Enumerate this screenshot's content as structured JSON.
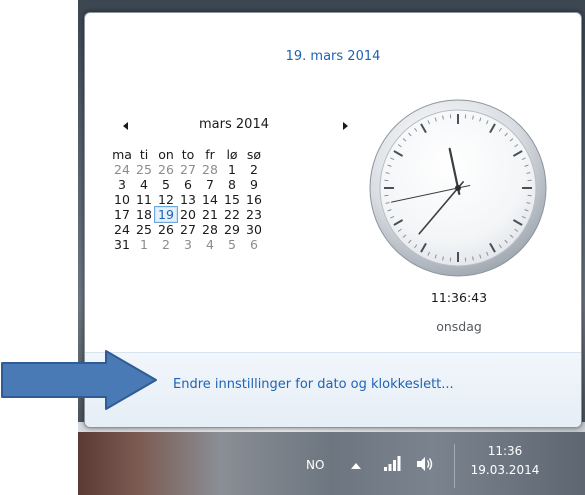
{
  "calendar": {
    "date_heading": "19. mars 2014",
    "month_title": "mars 2014",
    "prev_icon": "triangle-left-icon",
    "next_icon": "triangle-right-icon",
    "weekdays": [
      "ma",
      "ti",
      "on",
      "to",
      "fr",
      "lø",
      "sø"
    ],
    "weeks": [
      [
        "24",
        "25",
        "26",
        "27",
        "28",
        "1",
        "2"
      ],
      [
        "3",
        "4",
        "5",
        "6",
        "7",
        "8",
        "9"
      ],
      [
        "10",
        "11",
        "12",
        "13",
        "14",
        "15",
        "16"
      ],
      [
        "17",
        "18",
        "19",
        "20",
        "21",
        "22",
        "23"
      ],
      [
        "24",
        "25",
        "26",
        "27",
        "28",
        "29",
        "30"
      ],
      [
        "31",
        "1",
        "2",
        "3",
        "4",
        "5",
        "6"
      ]
    ],
    "selected_day": "19",
    "accent_color": "#1e63b4"
  },
  "clock": {
    "time": "11:36:43",
    "day": "onsdag",
    "hour": 11,
    "minute": 36,
    "second": 43
  },
  "footer": {
    "settings_link": "Endre innstillinger for dato og klokkeslett..."
  },
  "annotation": {
    "arrow_color": "#4a7ab5",
    "arrow_icon": "right-arrow-icon"
  },
  "taskbar": {
    "language": "NO",
    "show_hidden_icon": "chevron-up-icon",
    "network_icon": "signal-bars-icon",
    "volume_icon": "speaker-icon",
    "time": "11:36",
    "date": "19.03.2014"
  }
}
